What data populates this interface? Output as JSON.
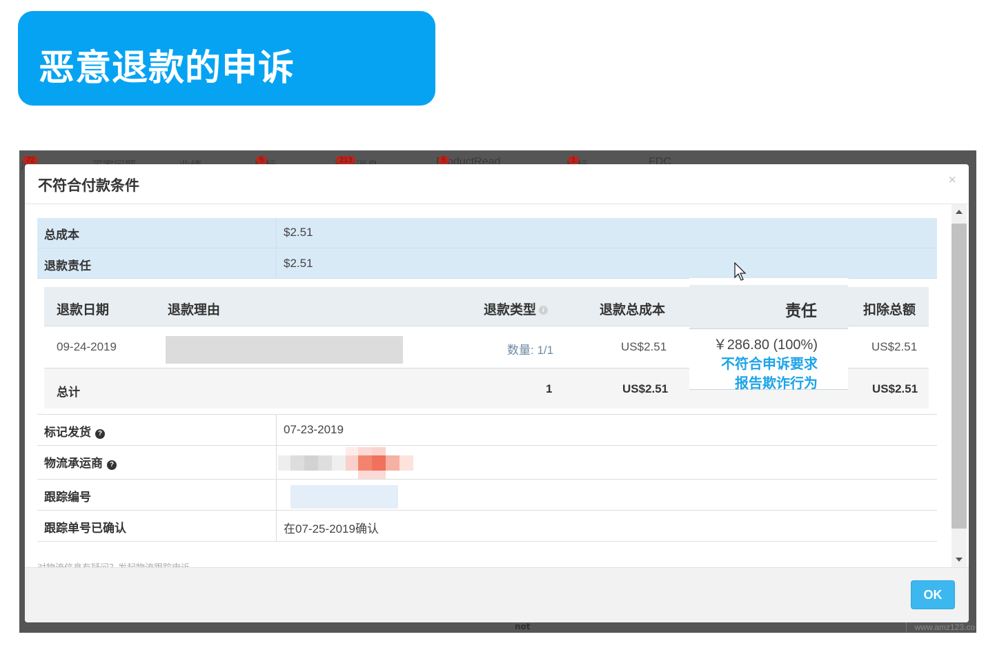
{
  "banner": {
    "title": "恶意退款的申诉"
  },
  "backdrop": {
    "nav_items": [
      {
        "label": "库",
        "badge": "72"
      },
      {
        "label": "买家问题"
      },
      {
        "label": "业绩"
      },
      {
        "label": "目标",
        "badge": "5"
      },
      {
        "label": "系统消息",
        "badge": "213"
      },
      {
        "label": "ProductRead",
        "badge": "5"
      },
      {
        "label": "目标",
        "badge": "1"
      },
      {
        "label": "FDC"
      }
    ],
    "bottom_text": "not",
    "watermark": "www.amz123.co"
  },
  "modal": {
    "title": "不符合付款条件",
    "close_label": "×",
    "summary": {
      "total_cost_label": "总成本",
      "total_cost_value": "$2.51",
      "refund_liability_label": "退款责任",
      "refund_liability_value": "$2.51"
    },
    "refund_table": {
      "headers": {
        "date": "退款日期",
        "reason": "退款理由",
        "type": "退款类型",
        "total_cost": "退款总成本",
        "deduction": "扣除总额"
      },
      "rows": [
        {
          "date": "09-24-2019",
          "quantity": "数量: 1/1",
          "total_cost": "US$2.51",
          "deduction": "US$2.51"
        }
      ],
      "total": {
        "label": "总计",
        "quantity": "1",
        "total_cost": "US$2.51",
        "deduction": "US$2.51"
      }
    },
    "callout": {
      "title": "责任",
      "amount": "￥286.80 (100%)",
      "link_appeal": "不符合申诉要求",
      "link_fraud": "报告欺诈行为"
    },
    "details": {
      "marked_shipped_label": "标记发货",
      "marked_shipped_value": "07-23-2019",
      "carrier_label": "物流承运商",
      "tracking_label": "跟踪编号",
      "tracking_confirmed_label": "跟踪单号已确认",
      "tracking_confirmed_value": "在07-25-2019确认"
    },
    "footnote": "对物流信息有疑问？发起物流跟踪申诉",
    "ok_label": "OK"
  },
  "colors": {
    "banner_bg": "#06a3f3",
    "summary_row_bg": "#d9eaf7",
    "link_blue": "#1ca3e8",
    "ok_button": "#3db7ef"
  },
  "icons": [
    "close-icon",
    "help-icon",
    "info-icon",
    "scroll-up-icon",
    "scroll-down-icon",
    "mouse-cursor-icon"
  ]
}
